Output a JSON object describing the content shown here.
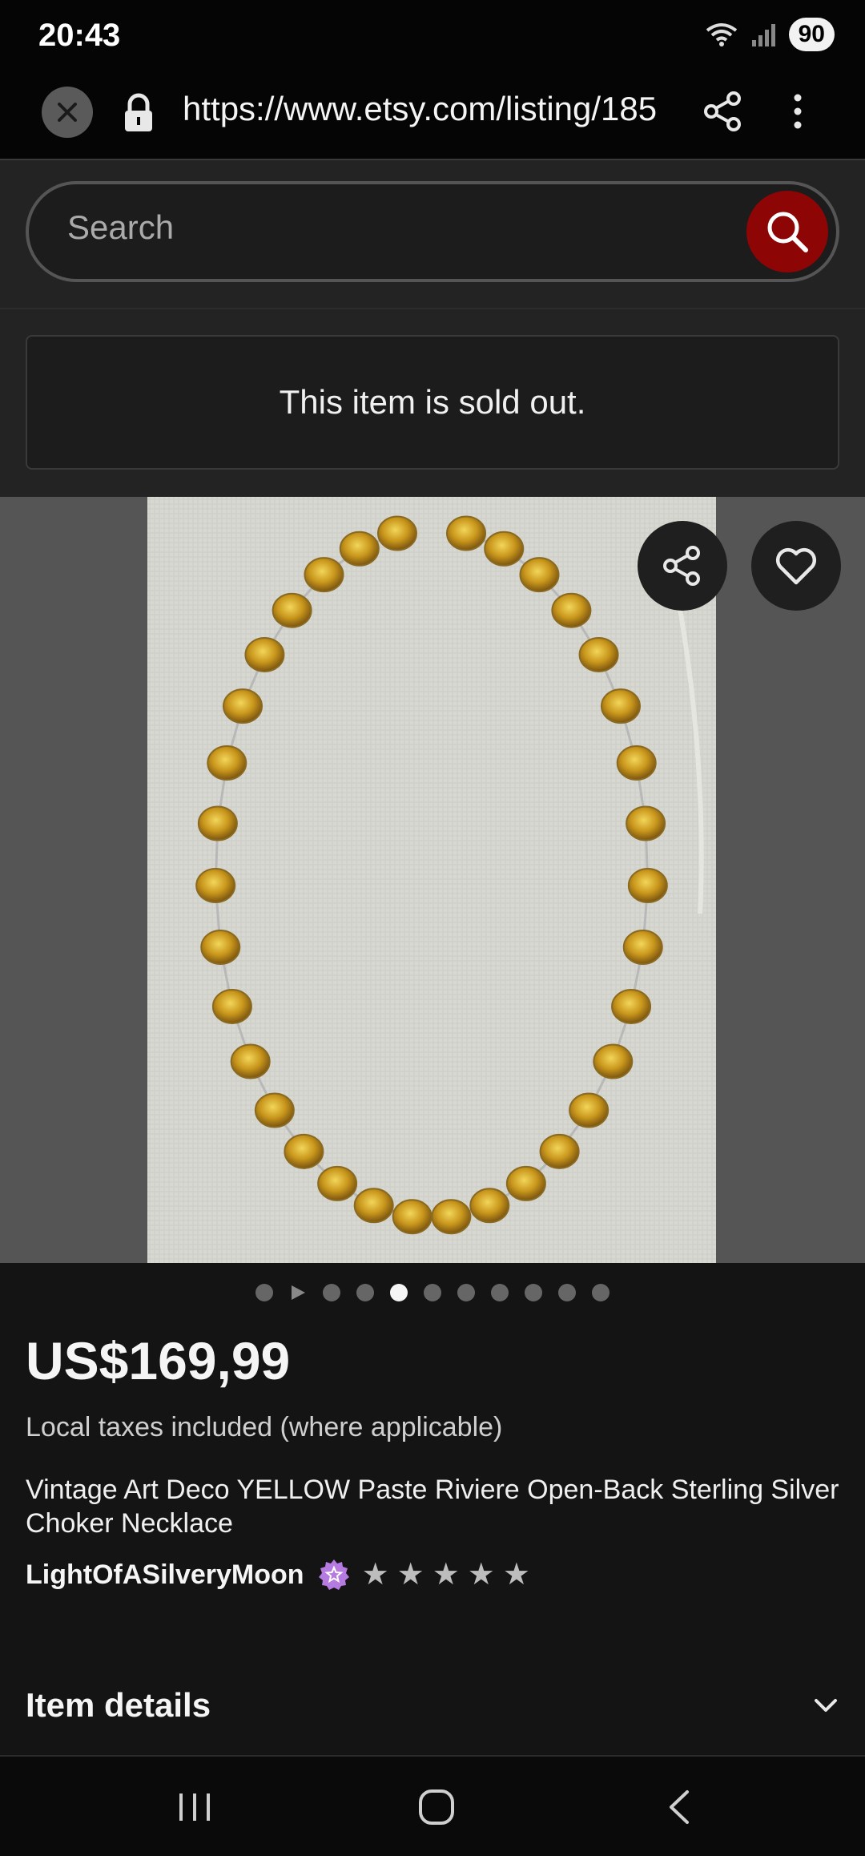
{
  "status_bar": {
    "time": "20:43",
    "battery": "90",
    "icons": [
      "wifi-icon",
      "signal-icon"
    ]
  },
  "browser": {
    "url": "https://www.etsy.com/listing/185",
    "icons": [
      "close-icon",
      "lock-icon",
      "share-icon",
      "more-vert-icon"
    ]
  },
  "search": {
    "placeholder": "Search",
    "icon": "search-icon",
    "accent_color": "#8e0505"
  },
  "notice": {
    "sold_out": "This item is sold out."
  },
  "gallery": {
    "image_alt": "Vintage yellow paste riviere necklace on linen",
    "dot_count": 11,
    "active_dot": 4,
    "icons": [
      "share-icon",
      "heart-icon",
      "play-icon"
    ]
  },
  "listing": {
    "price": "US$169,99",
    "taxes_note": "Local taxes included (where applicable)",
    "title": "Vintage Art Deco YELLOW Paste Riviere Open-Back Sterling Silver Choker Necklace",
    "seller": "LightOfASilveryMoon",
    "star_seller_badge_color": "#b57be0",
    "rating": 5
  },
  "sections": {
    "item_details": "Item details"
  },
  "nav": {
    "icons": [
      "recents-icon",
      "home-icon",
      "back-icon"
    ]
  }
}
